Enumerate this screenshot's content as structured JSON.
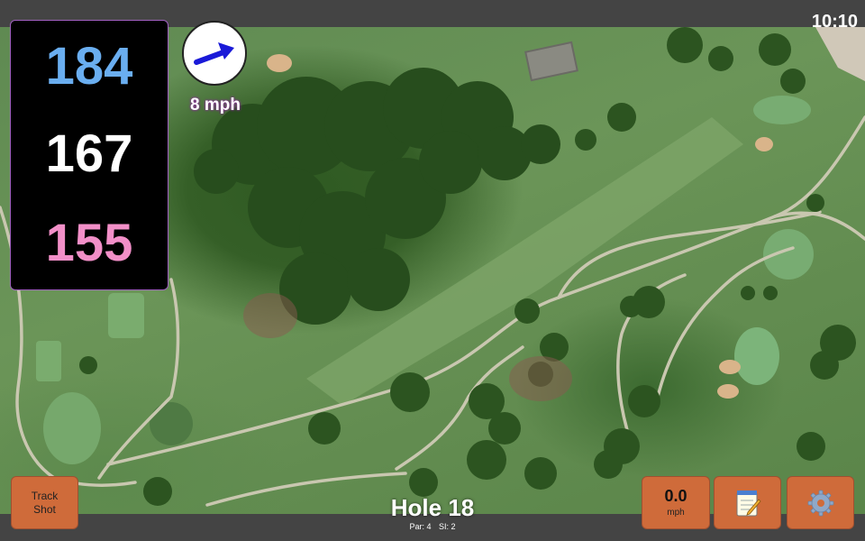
{
  "status_bar": {
    "time": "10:10"
  },
  "distances": {
    "back": "184",
    "middle": "167",
    "front": "155"
  },
  "wind": {
    "speed": "8 mph",
    "direction_icon": "arrow-icon"
  },
  "hole": {
    "title": "Hole 18",
    "par": "Par: 4",
    "si": "SI: 2"
  },
  "buttons": {
    "track_shot_line1": "Track",
    "track_shot_line2": "Shot",
    "speed_value": "0.0",
    "speed_unit": "mph",
    "notes_icon": "notepad-icon",
    "settings_icon": "gear-icon"
  },
  "colors": {
    "back_distance": "#6aaef0",
    "middle_distance": "#ffffff",
    "front_distance": "#f28fc8",
    "button_bg": "#cf6b3a",
    "wind_arrow": "#1a1ad8"
  }
}
